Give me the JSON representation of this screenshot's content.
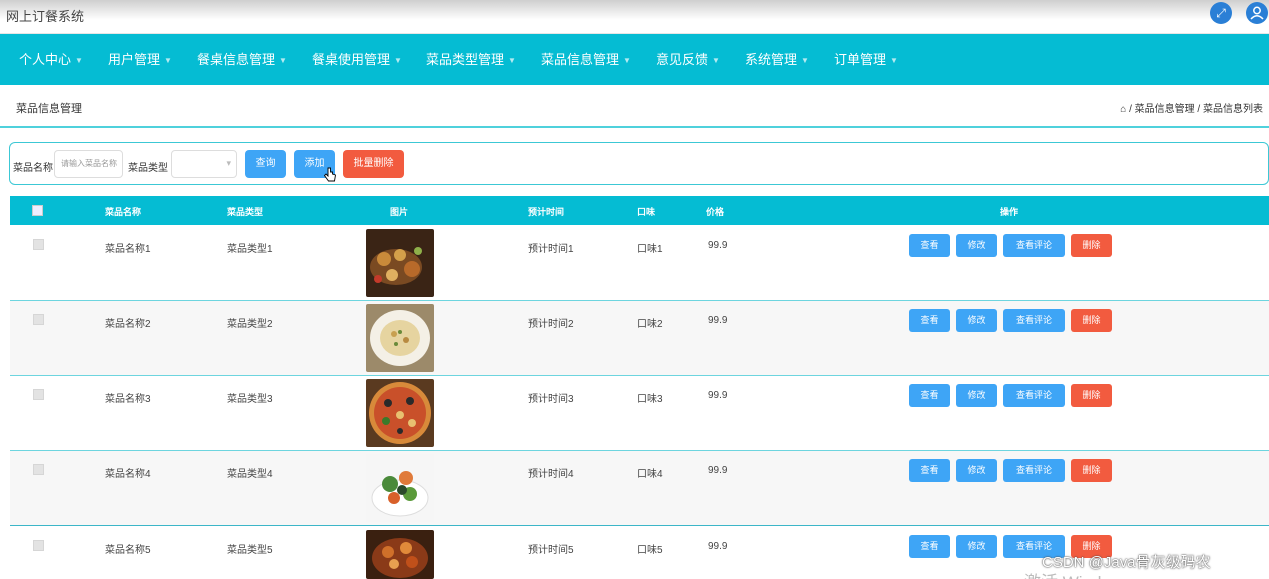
{
  "app": {
    "title": "网上订餐系统",
    "fullscreen_icon": "fullscreen-icon",
    "user_icon": "user-icon"
  },
  "nav": {
    "items": [
      {
        "label": "个人中心"
      },
      {
        "label": "用户管理"
      },
      {
        "label": "餐桌信息管理"
      },
      {
        "label": "餐桌使用管理"
      },
      {
        "label": "菜品类型管理"
      },
      {
        "label": "菜品信息管理"
      },
      {
        "label": "意见反馈"
      },
      {
        "label": "系统管理"
      },
      {
        "label": "订单管理"
      }
    ]
  },
  "page": {
    "title": "菜品信息管理",
    "breadcrumb": "⌂ / 菜品信息管理 / 菜品信息列表"
  },
  "search": {
    "name_label": "菜品名称",
    "name_placeholder": "请输入菜品名称",
    "type_label": "菜品类型",
    "type_value": "",
    "query_label": "查询",
    "add_label": "添加",
    "batch_delete_label": "批量删除"
  },
  "table": {
    "headers": [
      "菜品名称",
      "菜品类型",
      "图片",
      "预计时间",
      "口味",
      "价格",
      "操作"
    ],
    "rows": [
      {
        "name": "菜品名称1",
        "type": "菜品类型1",
        "time": "预计时间1",
        "taste": "口味1",
        "price": "99.9"
      },
      {
        "name": "菜品名称2",
        "type": "菜品类型2",
        "time": "预计时间2",
        "taste": "口味2",
        "price": "99.9"
      },
      {
        "name": "菜品名称3",
        "type": "菜品类型3",
        "time": "预计时间3",
        "taste": "口味3",
        "price": "99.9"
      },
      {
        "name": "菜品名称4",
        "type": "菜品类型4",
        "time": "预计时间4",
        "taste": "口味4",
        "price": "99.9"
      },
      {
        "name": "菜品名称5",
        "type": "菜品类型5",
        "time": "预计时间5",
        "taste": "口味5",
        "price": "99.9"
      }
    ],
    "actions": {
      "view": "查看",
      "edit": "修改",
      "comment": "查看评论",
      "delete": "删除"
    }
  },
  "overlay": {
    "watermark": "CSDN @Java骨灰级码农",
    "activate": "激活 Windows"
  },
  "colors": {
    "accent": "#05bcd3",
    "primary_button": "#3ea5f6",
    "danger_button": "#f25b3f"
  }
}
